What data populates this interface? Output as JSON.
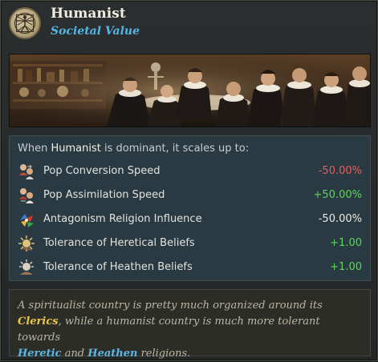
{
  "header": {
    "title": "Humanist",
    "subtitle": "Societal Value",
    "emblem_icon": "vitruvian-man-icon"
  },
  "painting": {
    "description_icon": "anatomy-lesson-painting"
  },
  "effects": {
    "intro_prefix": "When",
    "intro_highlight": "Humanist",
    "intro_suffix": "is dominant, it scales up to:",
    "items": [
      {
        "icon": "pop-conversion-icon",
        "label": "Pop Conversion Speed",
        "value": "-50.00%",
        "tone": "negative",
        "tone_color": "#e55f5f"
      },
      {
        "icon": "pop-assimilation-icon",
        "label": "Pop Assimilation Speed",
        "value": "+50.00%",
        "tone": "positive",
        "tone_color": "#5fd35f"
      },
      {
        "icon": "antagonism-religion-icon",
        "label": "Antagonism Religion Influence",
        "value": "-50.00%",
        "tone": "neutral",
        "tone_color": "#ecebe6"
      },
      {
        "icon": "heretic-tolerance-icon",
        "label": "Tolerance of Heretical Beliefs",
        "value": "+1.00",
        "tone": "positive",
        "tone_color": "#5fd35f"
      },
      {
        "icon": "heathen-tolerance-icon",
        "label": "Tolerance of Heathen Beliefs",
        "value": "+1.00",
        "tone": "positive",
        "tone_color": "#5fd35f"
      }
    ]
  },
  "description": {
    "line1": "A spiritualist country is pretty much organized around its",
    "kw_clerics": "Clerics",
    "line2_rest": ", while a humanist country is much more tolerant towards",
    "kw_heretic": "Heretic",
    "and_text": "and",
    "kw_heathen": "Heathen",
    "line3_rest": "religions."
  },
  "colors": {
    "subtitle": "#55b6e6",
    "keyword_gold": "#e8c84a",
    "keyword_blue": "#5ab8e6",
    "negative": "#e55f5f",
    "positive": "#5fd35f"
  }
}
